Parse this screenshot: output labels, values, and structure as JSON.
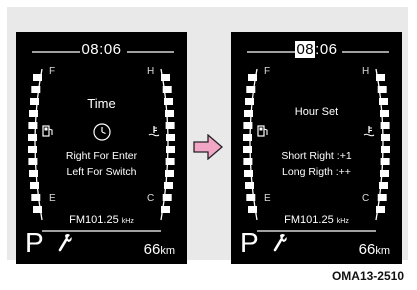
{
  "colors": {
    "screen_bg": "#000000",
    "frame_bg": "#e9e9e9",
    "arrow_fill": "#f2a6c6",
    "segment": "#ffffff"
  },
  "left_screen": {
    "clock": "08:06",
    "fuel_full_label": "F",
    "fuel_empty_label": "E",
    "temp_hot_label": "H",
    "temp_cold_label": "C",
    "menu_title": "Time",
    "menu_icon": "clock-icon",
    "line1": "Right For Enter",
    "line2": "Left For Switch",
    "radio_freq": "FM101.25",
    "radio_unit": "kHz",
    "gear": "P",
    "wrench_icon": "wrench-icon",
    "range_value": "66",
    "range_unit": "km"
  },
  "right_screen": {
    "clock_hour": "08",
    "clock_rest": ":06",
    "fuel_full_label": "F",
    "fuel_empty_label": "E",
    "temp_hot_label": "H",
    "temp_cold_label": "C",
    "menu_title": "Hour Set",
    "line1": "Short Right :+1",
    "line2": "Long Rigth :++",
    "radio_freq": "FM101.25",
    "radio_unit": "kHz",
    "gear": "P",
    "wrench_icon": "wrench-icon",
    "range_value": "66",
    "range_unit": "km"
  },
  "transition_arrow": "right-arrow-icon",
  "figure_code": "OMA13-2510"
}
